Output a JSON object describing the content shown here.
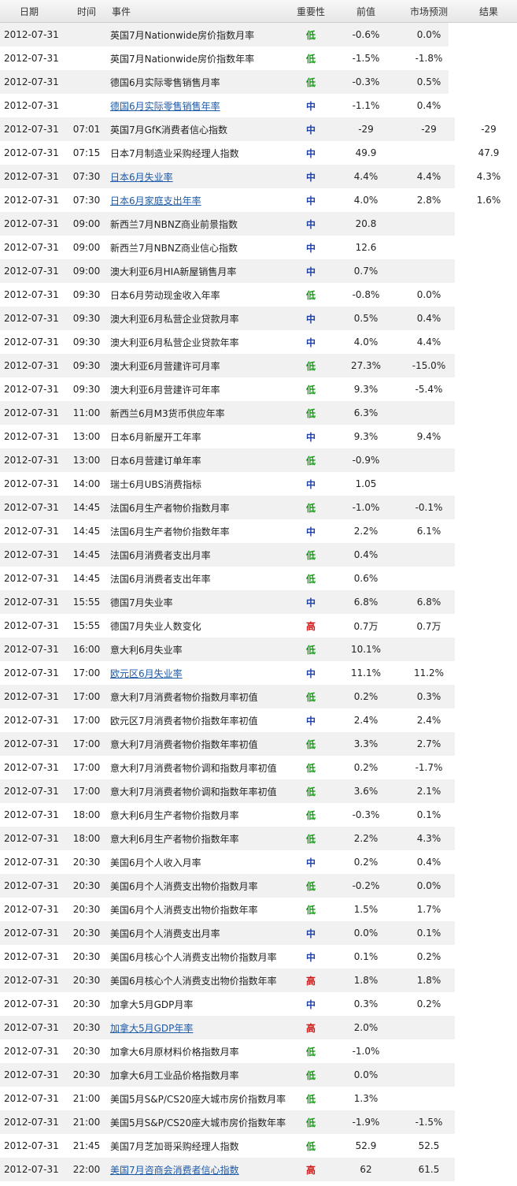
{
  "headers": [
    "日期",
    "时间",
    "事件",
    "重要性",
    "前值",
    "市场预测",
    "结果"
  ],
  "colors": {
    "low": "#1a9a1a",
    "mid": "#1d3fa7",
    "high": "#d01717",
    "link": "#1e5aa8"
  },
  "rows": [
    {
      "date": "2012-07-31",
      "time": "",
      "event": "英国7月Nationwide房价指数月率",
      "link": false,
      "imp": "低",
      "prev": "-0.6%",
      "fore": "0.0%",
      "res": ""
    },
    {
      "date": "2012-07-31",
      "time": "",
      "event": "英国7月Nationwide房价指数年率",
      "link": false,
      "imp": "低",
      "prev": "-1.5%",
      "fore": "-1.8%",
      "res": ""
    },
    {
      "date": "2012-07-31",
      "time": "",
      "event": "德国6月实际零售销售月率",
      "link": false,
      "imp": "低",
      "prev": "-0.3%",
      "fore": "0.5%",
      "res": ""
    },
    {
      "date": "2012-07-31",
      "time": "",
      "event": "德国6月实际零售销售年率",
      "link": true,
      "imp": "中",
      "prev": "-1.1%",
      "fore": "0.4%",
      "res": ""
    },
    {
      "date": "2012-07-31",
      "time": "07:01",
      "event": "英国7月GfK消费者信心指数",
      "link": false,
      "imp": "中",
      "prev": "-29",
      "fore": "-29",
      "res": "-29"
    },
    {
      "date": "2012-07-31",
      "time": "07:15",
      "event": "日本7月制造业采购经理人指数",
      "link": false,
      "imp": "中",
      "prev": "49.9",
      "fore": "",
      "res": "47.9"
    },
    {
      "date": "2012-07-31",
      "time": "07:30",
      "event": "日本6月失业率",
      "link": true,
      "imp": "中",
      "prev": "4.4%",
      "fore": "4.4%",
      "res": "4.3%"
    },
    {
      "date": "2012-07-31",
      "time": "07:30",
      "event": "日本6月家庭支出年率",
      "link": true,
      "imp": "中",
      "prev": "4.0%",
      "fore": "2.8%",
      "res": "1.6%"
    },
    {
      "date": "2012-07-31",
      "time": "09:00",
      "event": "新西兰7月NBNZ商业前景指数",
      "link": false,
      "imp": "中",
      "prev": "20.8",
      "fore": "",
      "res": ""
    },
    {
      "date": "2012-07-31",
      "time": "09:00",
      "event": "新西兰7月NBNZ商业信心指数",
      "link": false,
      "imp": "中",
      "prev": "12.6",
      "fore": "",
      "res": ""
    },
    {
      "date": "2012-07-31",
      "time": "09:00",
      "event": "澳大利亚6月HIA新屋销售月率",
      "link": false,
      "imp": "中",
      "prev": "0.7%",
      "fore": "",
      "res": ""
    },
    {
      "date": "2012-07-31",
      "time": "09:30",
      "event": "日本6月劳动现金收入年率",
      "link": false,
      "imp": "低",
      "prev": "-0.8%",
      "fore": "0.0%",
      "res": ""
    },
    {
      "date": "2012-07-31",
      "time": "09:30",
      "event": "澳大利亚6月私营企业贷款月率",
      "link": false,
      "imp": "中",
      "prev": "0.5%",
      "fore": "0.4%",
      "res": ""
    },
    {
      "date": "2012-07-31",
      "time": "09:30",
      "event": "澳大利亚6月私营企业贷款年率",
      "link": false,
      "imp": "中",
      "prev": "4.0%",
      "fore": "4.4%",
      "res": ""
    },
    {
      "date": "2012-07-31",
      "time": "09:30",
      "event": "澳大利亚6月营建许可月率",
      "link": false,
      "imp": "低",
      "prev": "27.3%",
      "fore": "-15.0%",
      "res": ""
    },
    {
      "date": "2012-07-31",
      "time": "09:30",
      "event": "澳大利亚6月营建许可年率",
      "link": false,
      "imp": "低",
      "prev": "9.3%",
      "fore": "-5.4%",
      "res": ""
    },
    {
      "date": "2012-07-31",
      "time": "11:00",
      "event": "新西兰6月M3货币供应年率",
      "link": false,
      "imp": "低",
      "prev": "6.3%",
      "fore": "",
      "res": ""
    },
    {
      "date": "2012-07-31",
      "time": "13:00",
      "event": "日本6月新屋开工年率",
      "link": false,
      "imp": "中",
      "prev": "9.3%",
      "fore": "9.4%",
      "res": ""
    },
    {
      "date": "2012-07-31",
      "time": "13:00",
      "event": "日本6月营建订单年率",
      "link": false,
      "imp": "低",
      "prev": "-0.9%",
      "fore": "",
      "res": ""
    },
    {
      "date": "2012-07-31",
      "time": "14:00",
      "event": "瑞士6月UBS消费指标",
      "link": false,
      "imp": "中",
      "prev": "1.05",
      "fore": "",
      "res": ""
    },
    {
      "date": "2012-07-31",
      "time": "14:45",
      "event": "法国6月生产者物价指数月率",
      "link": false,
      "imp": "低",
      "prev": "-1.0%",
      "fore": "-0.1%",
      "res": ""
    },
    {
      "date": "2012-07-31",
      "time": "14:45",
      "event": "法国6月生产者物价指数年率",
      "link": false,
      "imp": "中",
      "prev": "2.2%",
      "fore": "6.1%",
      "res": ""
    },
    {
      "date": "2012-07-31",
      "time": "14:45",
      "event": "法国6月消费者支出月率",
      "link": false,
      "imp": "低",
      "prev": "0.4%",
      "fore": "",
      "res": ""
    },
    {
      "date": "2012-07-31",
      "time": "14:45",
      "event": "法国6月消费者支出年率",
      "link": false,
      "imp": "低",
      "prev": "0.6%",
      "fore": "",
      "res": ""
    },
    {
      "date": "2012-07-31",
      "time": "15:55",
      "event": "德国7月失业率",
      "link": false,
      "imp": "中",
      "prev": "6.8%",
      "fore": "6.8%",
      "res": ""
    },
    {
      "date": "2012-07-31",
      "time": "15:55",
      "event": "德国7月失业人数变化",
      "link": false,
      "imp": "高",
      "prev": "0.7万",
      "fore": "0.7万",
      "res": ""
    },
    {
      "date": "2012-07-31",
      "time": "16:00",
      "event": "意大利6月失业率",
      "link": false,
      "imp": "低",
      "prev": "10.1%",
      "fore": "",
      "res": ""
    },
    {
      "date": "2012-07-31",
      "time": "17:00",
      "event": "欧元区6月失业率",
      "link": true,
      "imp": "中",
      "prev": "11.1%",
      "fore": "11.2%",
      "res": ""
    },
    {
      "date": "2012-07-31",
      "time": "17:00",
      "event": "意大利7月消费者物价指数月率初值",
      "link": false,
      "imp": "低",
      "prev": "0.2%",
      "fore": "0.3%",
      "res": ""
    },
    {
      "date": "2012-07-31",
      "time": "17:00",
      "event": "欧元区7月消费者物价指数年率初值",
      "link": false,
      "imp": "中",
      "prev": "2.4%",
      "fore": "2.4%",
      "res": ""
    },
    {
      "date": "2012-07-31",
      "time": "17:00",
      "event": "意大利7月消费者物价指数年率初值",
      "link": false,
      "imp": "低",
      "prev": "3.3%",
      "fore": "2.7%",
      "res": ""
    },
    {
      "date": "2012-07-31",
      "time": "17:00",
      "event": "意大利7月消费者物价调和指数月率初值",
      "link": false,
      "imp": "低",
      "prev": "0.2%",
      "fore": "-1.7%",
      "res": ""
    },
    {
      "date": "2012-07-31",
      "time": "17:00",
      "event": "意大利7月消费者物价调和指数年率初值",
      "link": false,
      "imp": "低",
      "prev": "3.6%",
      "fore": "2.1%",
      "res": ""
    },
    {
      "date": "2012-07-31",
      "time": "18:00",
      "event": "意大利6月生产者物价指数月率",
      "link": false,
      "imp": "低",
      "prev": "-0.3%",
      "fore": "0.1%",
      "res": ""
    },
    {
      "date": "2012-07-31",
      "time": "18:00",
      "event": "意大利6月生产者物价指数年率",
      "link": false,
      "imp": "低",
      "prev": "2.2%",
      "fore": "4.3%",
      "res": ""
    },
    {
      "date": "2012-07-31",
      "time": "20:30",
      "event": "美国6月个人收入月率",
      "link": false,
      "imp": "中",
      "prev": "0.2%",
      "fore": "0.4%",
      "res": ""
    },
    {
      "date": "2012-07-31",
      "time": "20:30",
      "event": "美国6月个人消费支出物价指数月率",
      "link": false,
      "imp": "低",
      "prev": "-0.2%",
      "fore": "0.0%",
      "res": ""
    },
    {
      "date": "2012-07-31",
      "time": "20:30",
      "event": "美国6月个人消费支出物价指数年率",
      "link": false,
      "imp": "低",
      "prev": "1.5%",
      "fore": "1.7%",
      "res": ""
    },
    {
      "date": "2012-07-31",
      "time": "20:30",
      "event": "美国6月个人消费支出月率",
      "link": false,
      "imp": "中",
      "prev": "0.0%",
      "fore": "0.1%",
      "res": ""
    },
    {
      "date": "2012-07-31",
      "time": "20:30",
      "event": "美国6月核心个人消费支出物价指数月率",
      "link": false,
      "imp": "中",
      "prev": "0.1%",
      "fore": "0.2%",
      "res": ""
    },
    {
      "date": "2012-07-31",
      "time": "20:30",
      "event": "美国6月核心个人消费支出物价指数年率",
      "link": false,
      "imp": "高",
      "prev": "1.8%",
      "fore": "1.8%",
      "res": ""
    },
    {
      "date": "2012-07-31",
      "time": "20:30",
      "event": "加拿大5月GDP月率",
      "link": false,
      "imp": "中",
      "prev": "0.3%",
      "fore": "0.2%",
      "res": ""
    },
    {
      "date": "2012-07-31",
      "time": "20:30",
      "event": "加拿大5月GDP年率",
      "link": true,
      "imp": "高",
      "prev": "2.0%",
      "fore": "",
      "res": ""
    },
    {
      "date": "2012-07-31",
      "time": "20:30",
      "event": "加拿大6月原材料价格指数月率",
      "link": false,
      "imp": "低",
      "prev": "-1.0%",
      "fore": "",
      "res": ""
    },
    {
      "date": "2012-07-31",
      "time": "20:30",
      "event": "加拿大6月工业品价格指数月率",
      "link": false,
      "imp": "低",
      "prev": "0.0%",
      "fore": "",
      "res": ""
    },
    {
      "date": "2012-07-31",
      "time": "21:00",
      "event": "美国5月S&P/CS20座大城市房价指数月率",
      "link": false,
      "imp": "低",
      "prev": "1.3%",
      "fore": "",
      "res": ""
    },
    {
      "date": "2012-07-31",
      "time": "21:00",
      "event": "美国5月S&P/CS20座大城市房价指数年率",
      "link": false,
      "imp": "低",
      "prev": "-1.9%",
      "fore": "-1.5%",
      "res": ""
    },
    {
      "date": "2012-07-31",
      "time": "21:45",
      "event": "美国7月芝加哥采购经理人指数",
      "link": false,
      "imp": "低",
      "prev": "52.9",
      "fore": "52.5",
      "res": ""
    },
    {
      "date": "2012-07-31",
      "time": "22:00",
      "event": "美国7月咨商会消费者信心指数",
      "link": true,
      "imp": "高",
      "prev": "62",
      "fore": "61.5",
      "res": ""
    }
  ]
}
